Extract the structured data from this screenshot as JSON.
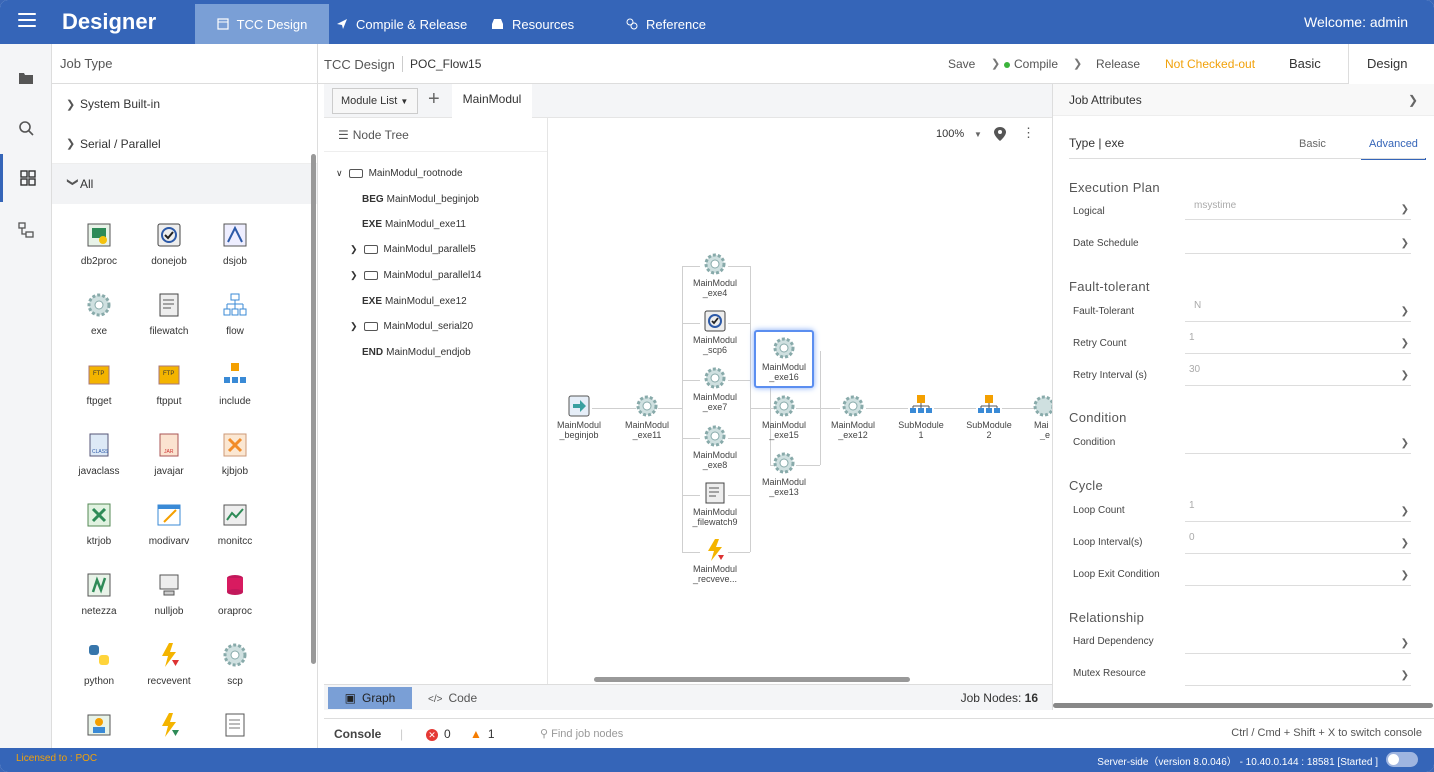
{
  "header": {
    "brand": "Designer",
    "nav": [
      {
        "label": "TCC Design"
      },
      {
        "label": "Compile & Release"
      },
      {
        "label": "Resources"
      },
      {
        "label": "Reference"
      }
    ],
    "welcome": "Welcome: admin"
  },
  "job_type": {
    "title": "Job Type",
    "groups": [
      {
        "label": "System Built-in"
      },
      {
        "label": "Serial / Parallel"
      },
      {
        "label": "All"
      }
    ],
    "items": [
      "db2proc",
      "donejob",
      "dsjob",
      "exe",
      "filewatch",
      "flow",
      "ftpget",
      "ftpput",
      "include",
      "javaclass",
      "javajar",
      "kjbjob",
      "ktrjob",
      "modivarv",
      "monitcc",
      "netezza",
      "nulljob",
      "oraproc",
      "python",
      "recvevent",
      "scp"
    ]
  },
  "toolbar": {
    "section": "TCC Design",
    "flow": "POC_Flow15",
    "save": "Save",
    "compile": "Compile",
    "release": "Release",
    "status": "Not Checked-out",
    "basic": "Basic",
    "design": "Design"
  },
  "editor": {
    "module_list": "Module List",
    "tab": "MainModul",
    "node_tree_title": "Node Tree",
    "tree": [
      {
        "tag": "",
        "label": "MainModul_rootnode"
      },
      {
        "tag": "BEG",
        "label": "MainModul_beginjob"
      },
      {
        "tag": "EXE",
        "label": "MainModul_exe11"
      },
      {
        "tag": "",
        "label": "MainModul_parallel5"
      },
      {
        "tag": "",
        "label": "MainModul_parallel14"
      },
      {
        "tag": "EXE",
        "label": "MainModul_exe12"
      },
      {
        "tag": "",
        "label": "MainModul_serial20"
      },
      {
        "tag": "END",
        "label": "MainModul_endjob"
      }
    ],
    "zoom": "100%",
    "graph_nodes": {
      "begin": [
        "MainModul",
        "_beginjob"
      ],
      "exe11": [
        "MainModul",
        "_exe11"
      ],
      "exe4": [
        "MainModul",
        "_exe4"
      ],
      "scp6": [
        "MainModul",
        "_scp6"
      ],
      "exe7": [
        "MainModul",
        "_exe7"
      ],
      "exe8": [
        "MainModul",
        "_exe8"
      ],
      "fw9": [
        "MainModul",
        "_filewatch9"
      ],
      "recv": [
        "MainModul",
        "_recveve..."
      ],
      "exe16": [
        "MainModul",
        "_exe16"
      ],
      "exe15": [
        "MainModul",
        "_exe15"
      ],
      "exe13": [
        "MainModul",
        "_exe13"
      ],
      "exe12": [
        "MainModul",
        "_exe12"
      ],
      "sub1": [
        "SubModule",
        "1"
      ],
      "sub2": [
        "SubModule",
        "2"
      ],
      "trunc": [
        "Mai",
        "_e"
      ]
    },
    "graph_btn": "Graph",
    "code_btn": "Code",
    "job_nodes_label": "Job Nodes:",
    "job_nodes_count": "16"
  },
  "attributes": {
    "title": "Job Attributes",
    "type": "Type | exe",
    "tab_basic": "Basic",
    "tab_advanced": "Advanced",
    "sections": {
      "exec": "Execution Plan",
      "fault": "Fault-tolerant",
      "cond": "Condition",
      "cycle": "Cycle",
      "rel": "Relationship"
    },
    "fields": {
      "logical": {
        "label": "Logical",
        "value": "msystime"
      },
      "date": {
        "label": "Date Schedule",
        "value": ""
      },
      "ft": {
        "label": "Fault-Tolerant",
        "value": "N"
      },
      "retry": {
        "label": "Retry Count",
        "value": "1"
      },
      "interval": {
        "label": "Retry Interval (s)",
        "value": "30"
      },
      "condition": {
        "label": "Condition",
        "value": ""
      },
      "loop": {
        "label": "Loop Count",
        "value": "1"
      },
      "loopint": {
        "label": "Loop Interval(s)",
        "value": "0"
      },
      "loopexit": {
        "label": "Loop Exit Condition",
        "value": ""
      },
      "hard": {
        "label": "Hard Dependency",
        "value": ""
      },
      "mutex": {
        "label": "Mutex Resource",
        "value": ""
      }
    }
  },
  "console": {
    "label": "Console",
    "errors": "0",
    "warnings": "1",
    "find_placeholder": "Find job nodes",
    "hint": "Ctrl / Cmd + Shift + X to switch console"
  },
  "footer": {
    "license": "Licensed to : POC",
    "server": "Server-side（version 8.0.046） - 10.40.0.144 : 18581 [Started ]"
  },
  "colors": {
    "primary": "#3565b8",
    "active_tab": "#7a9fd6",
    "warning": "#f1a10a"
  }
}
